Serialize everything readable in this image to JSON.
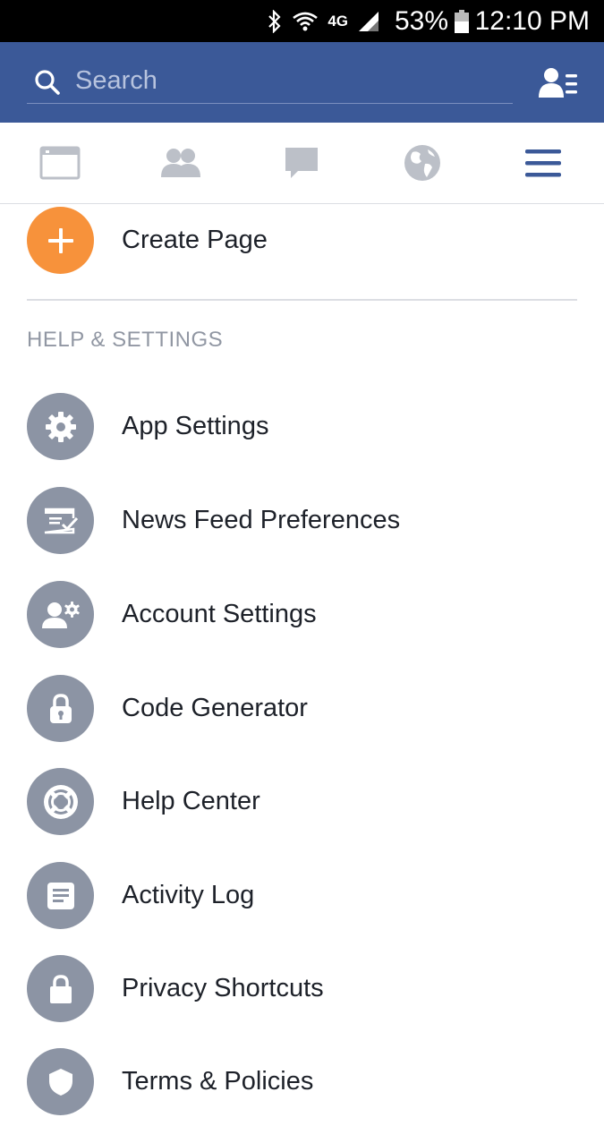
{
  "status_bar": {
    "icons": [
      "bluetooth-icon",
      "wifi-icon",
      "network-4g-icon",
      "signal-icon"
    ],
    "network_label": "4G",
    "battery_percent": "53%",
    "time": "12:10 PM"
  },
  "header": {
    "search_placeholder": "Search",
    "accent_color": "#3b5998"
  },
  "tabs": [
    {
      "name": "news-feed-icon",
      "active": false
    },
    {
      "name": "friends-icon",
      "active": false
    },
    {
      "name": "messages-icon",
      "active": false
    },
    {
      "name": "notifications-globe-icon",
      "active": false
    },
    {
      "name": "menu-icon",
      "active": true
    }
  ],
  "create_page": {
    "label": "Create Page",
    "icon": "plus-icon",
    "color": "#f7923b"
  },
  "help_settings": {
    "header": "HELP & SETTINGS",
    "items": [
      {
        "label": "App Settings",
        "icon": "gear-icon"
      },
      {
        "label": "News Feed Preferences",
        "icon": "news-feed-preferences-icon"
      },
      {
        "label": "Account Settings",
        "icon": "account-settings-icon"
      },
      {
        "label": "Code Generator",
        "icon": "code-generator-icon"
      },
      {
        "label": "Help Center",
        "icon": "lifebuoy-icon"
      },
      {
        "label": "Activity Log",
        "icon": "activity-log-icon"
      },
      {
        "label": "Privacy Shortcuts",
        "icon": "lock-icon"
      },
      {
        "label": "Terms & Policies",
        "icon": "terms-icon"
      }
    ]
  }
}
